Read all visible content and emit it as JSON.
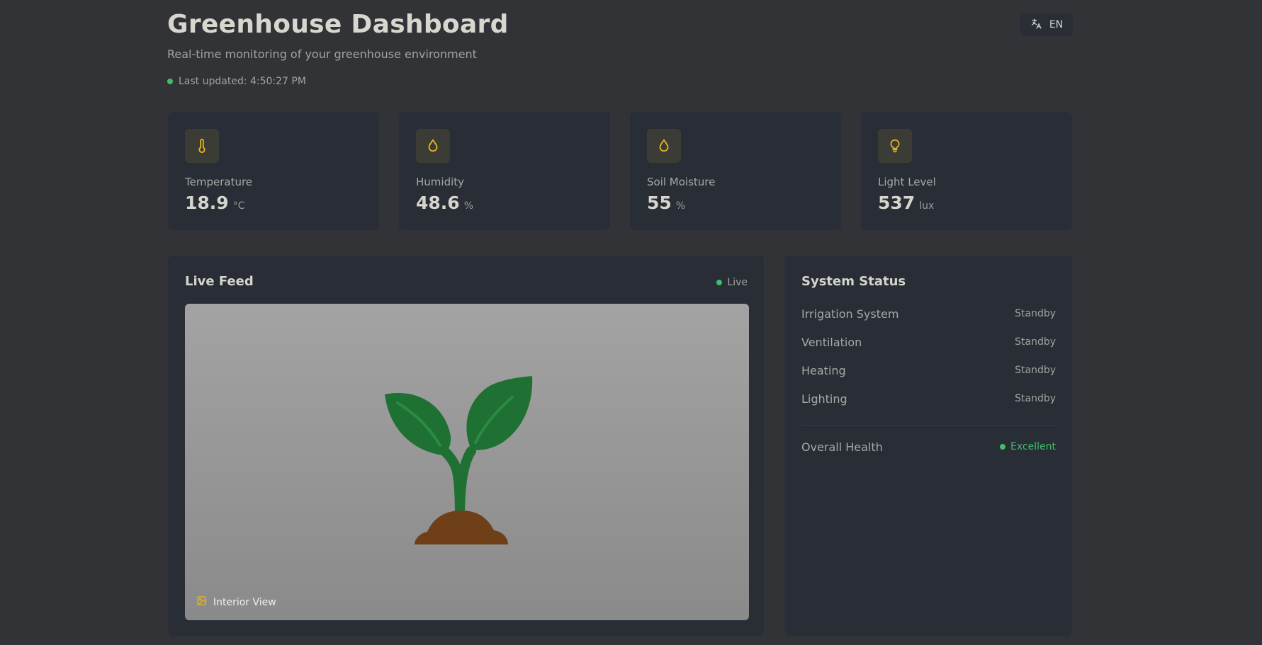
{
  "header": {
    "title": "Greenhouse Dashboard",
    "subtitle": "Real-time monitoring of your greenhouse environment",
    "last_updated": "Last updated: 4:50:27 PM",
    "language": "EN"
  },
  "metrics": [
    {
      "label": "Temperature",
      "value": "18.9",
      "unit": "°C",
      "icon": "thermometer-icon"
    },
    {
      "label": "Humidity",
      "value": "48.6",
      "unit": "%",
      "icon": "droplet-icon"
    },
    {
      "label": "Soil Moisture",
      "value": "55",
      "unit": "%",
      "icon": "droplet-icon"
    },
    {
      "label": "Light Level",
      "value": "537",
      "unit": "lux",
      "icon": "lightbulb-icon"
    }
  ],
  "feed": {
    "title": "Live Feed",
    "live_label": "Live",
    "caption": "Interior View"
  },
  "status": {
    "title": "System Status",
    "systems": [
      {
        "name": "Irrigation System",
        "state": "Standby"
      },
      {
        "name": "Ventilation",
        "state": "Standby"
      },
      {
        "name": "Heating",
        "state": "Standby"
      },
      {
        "name": "Lighting",
        "state": "Standby"
      }
    ],
    "health_label": "Overall Health",
    "health_value": "Excellent"
  },
  "colors": {
    "accent": "#e6b422",
    "live_green": "#3fbf69",
    "plant_green": "#1f7033",
    "soil_brown": "#6f4018"
  }
}
